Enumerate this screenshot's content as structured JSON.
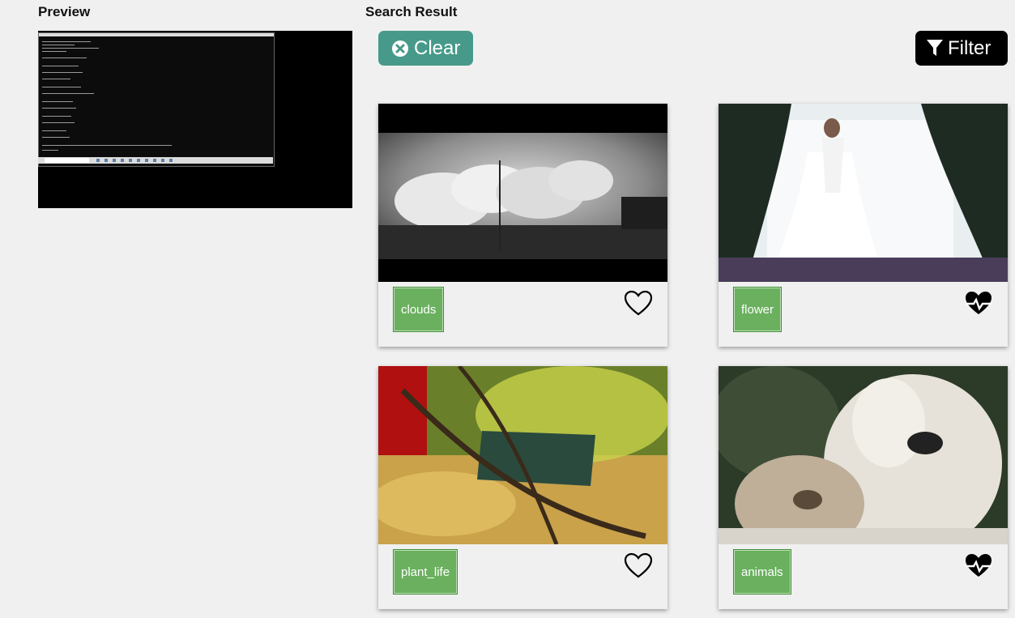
{
  "preview": {
    "title": "Preview"
  },
  "results": {
    "title": "Search Result",
    "clear_label": "Clear",
    "filter_label": "Filter"
  },
  "cards": [
    {
      "tag": "clouds",
      "liked": false
    },
    {
      "tag": "flower",
      "liked": true
    },
    {
      "tag": "plant_life",
      "liked": false
    },
    {
      "tag": "animals",
      "liked": true
    }
  ],
  "colors": {
    "clear_button": "#479a89",
    "filter_button": "#000000",
    "tag_green": "#6ab05f"
  },
  "icons": {
    "clear": "times-circle-icon",
    "filter": "filter-icon",
    "like_outline": "heart-outline-icon",
    "like_filled": "heartbeat-icon"
  }
}
